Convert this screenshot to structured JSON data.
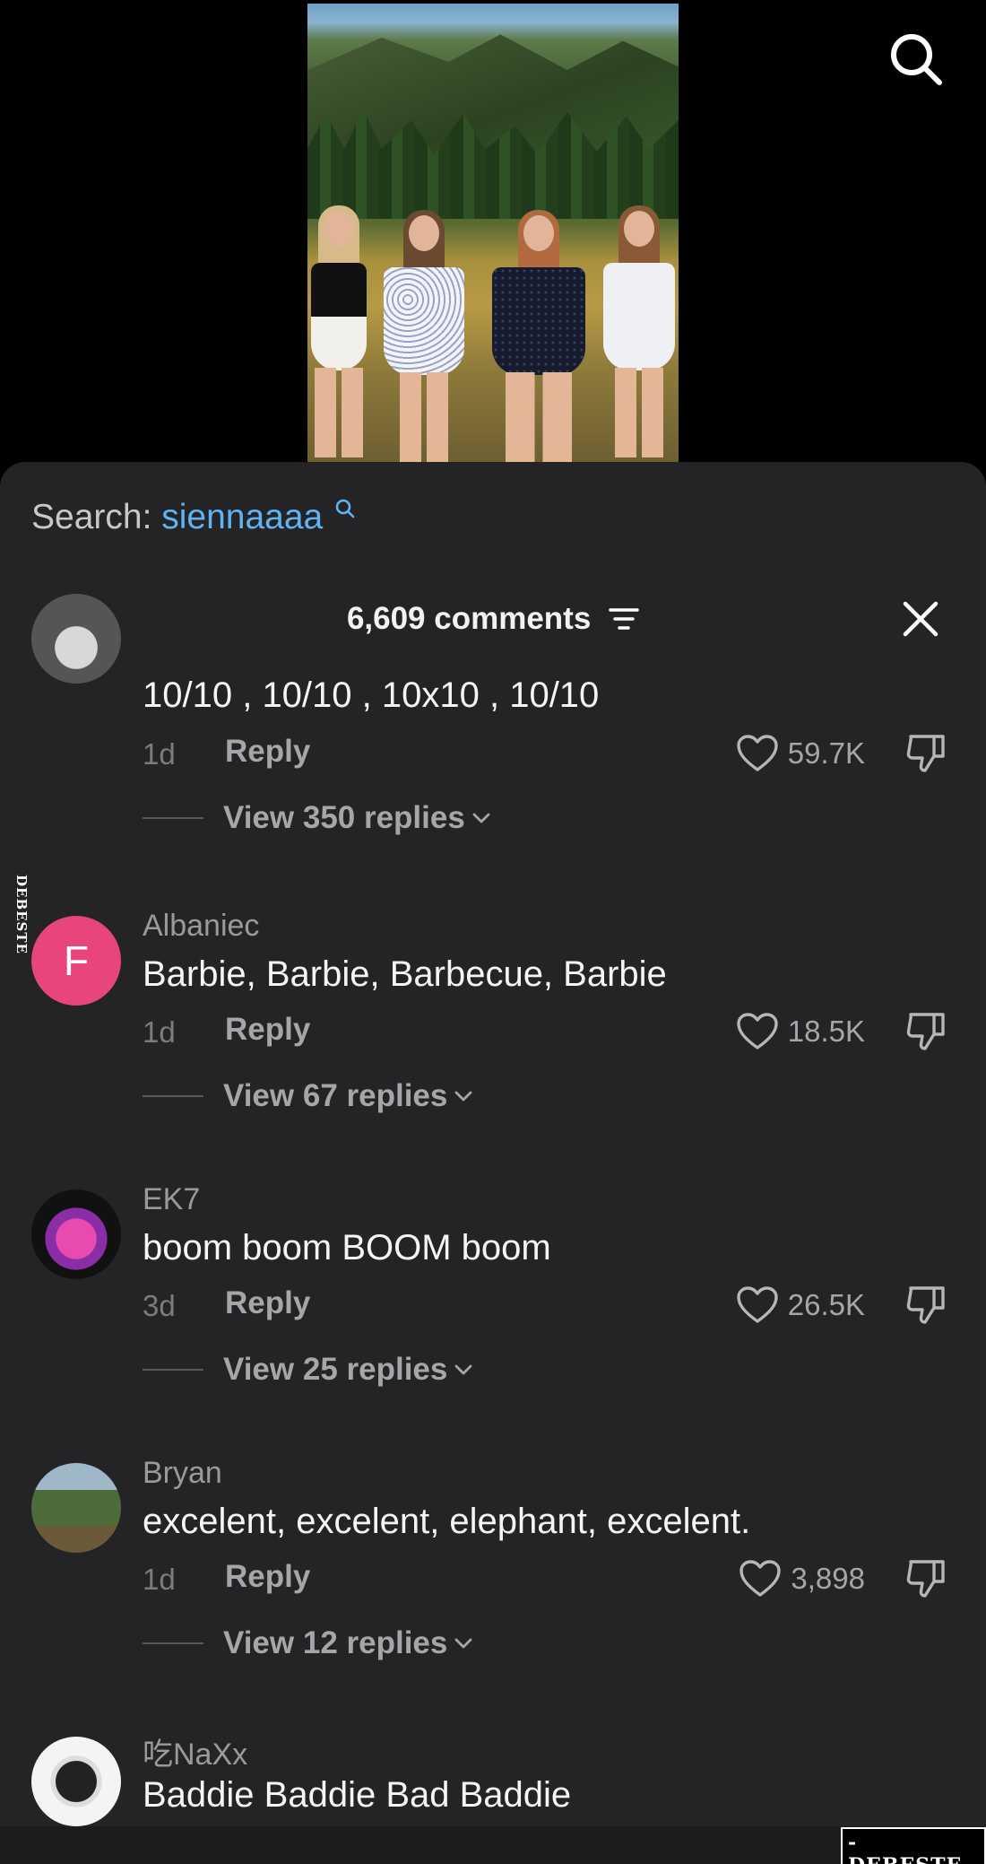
{
  "search": {
    "label": "Search:",
    "term": "siennaaaa"
  },
  "comments_header": {
    "count_label": "6,609 comments"
  },
  "comments": [
    {
      "username": "",
      "text": "10/10 , 10/10 , 10x10 , 10/10",
      "age": "1d",
      "reply_label": "Reply",
      "likes": "59.7K",
      "view_replies": "View 350 replies"
    },
    {
      "username": "Albaniec",
      "avatar_letter": "F",
      "text": "Barbie, Barbie, Barbecue, Barbie",
      "age": "1d",
      "reply_label": "Reply",
      "likes": "18.5K",
      "view_replies": "View 67 replies"
    },
    {
      "username": "EK7",
      "text": "boom boom BOOM boom",
      "age": "3d",
      "reply_label": "Reply",
      "likes": "26.5K",
      "view_replies": "View 25 replies"
    },
    {
      "username": "Bryan",
      "text": "excelent, excelent, elephant, excelent.",
      "age": "1d",
      "reply_label": "Reply",
      "likes": "3,898",
      "view_replies": "View 12 replies"
    },
    {
      "username": "吃NaXx",
      "text": "Baddie Baddie Bad Baddie"
    }
  ],
  "watermark": {
    "side": "DEBESTE",
    "bottom": "-DEBESTE-"
  },
  "colors": {
    "accent_search": "#5fb3f0",
    "sheet_bg": "#242426",
    "avatar_pink": "#e8457a"
  }
}
